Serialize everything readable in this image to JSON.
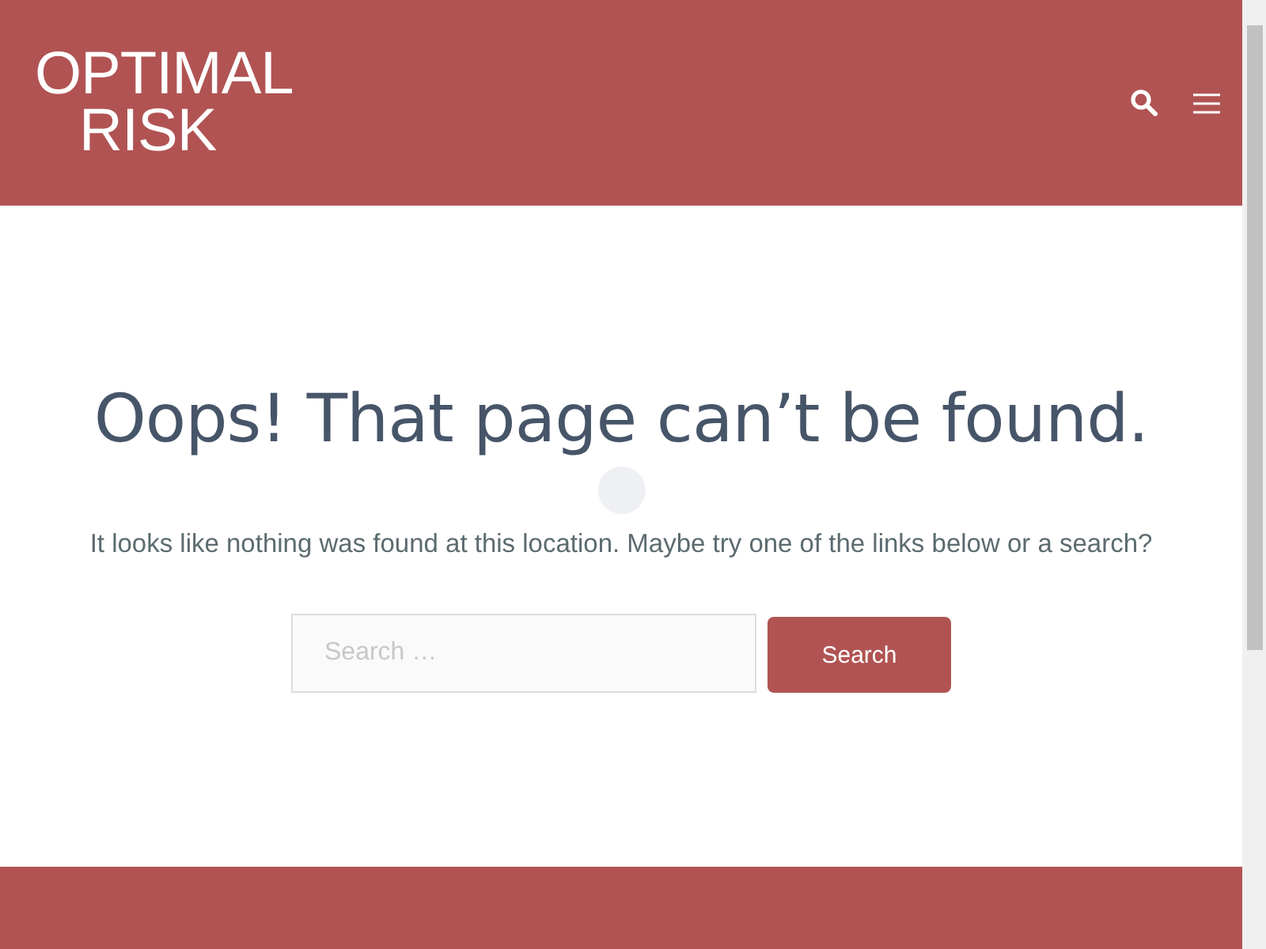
{
  "header": {
    "logo": {
      "line_1": "OPTIMAL",
      "line_2": "RISK"
    }
  },
  "content": {
    "title": "Oops! That page can’t be found.",
    "message": "It looks like nothing was found at this location. Maybe try one of the links below or a search?",
    "search": {
      "placeholder": "Search …",
      "button": "Search"
    }
  }
}
